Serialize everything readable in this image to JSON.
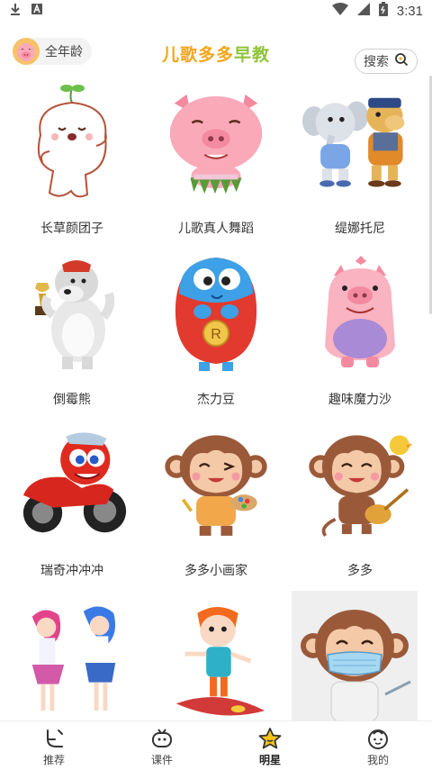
{
  "status": {
    "time": "3:31"
  },
  "header": {
    "age_label": "全年龄",
    "brand_chars": [
      "儿",
      "歌",
      "多",
      "多",
      "早",
      "教"
    ],
    "brand_colors": [
      "#f2a61b",
      "#f2a61b",
      "#f2a61b",
      "#f2a61b",
      "#8fc43b",
      "#8fc43b"
    ],
    "search_label": "搜索"
  },
  "characters": [
    {
      "label": "长草颜团子"
    },
    {
      "label": "儿歌真人舞蹈"
    },
    {
      "label": "缇娜托尼"
    },
    {
      "label": "倒霉熊"
    },
    {
      "label": "杰力豆"
    },
    {
      "label": "趣味魔力沙"
    },
    {
      "label": "瑞奇冲冲冲"
    },
    {
      "label": "多多小画家"
    },
    {
      "label": "多多"
    }
  ],
  "tabs": [
    {
      "label": "推荐",
      "icon": "recommend-icon"
    },
    {
      "label": "课件",
      "icon": "courseware-icon"
    },
    {
      "label": "明星",
      "icon": "star-icon",
      "active": true
    },
    {
      "label": "我的",
      "icon": "profile-icon"
    }
  ],
  "colors": {
    "accent": "#f2a61b",
    "active_star": "#f6c31a"
  }
}
